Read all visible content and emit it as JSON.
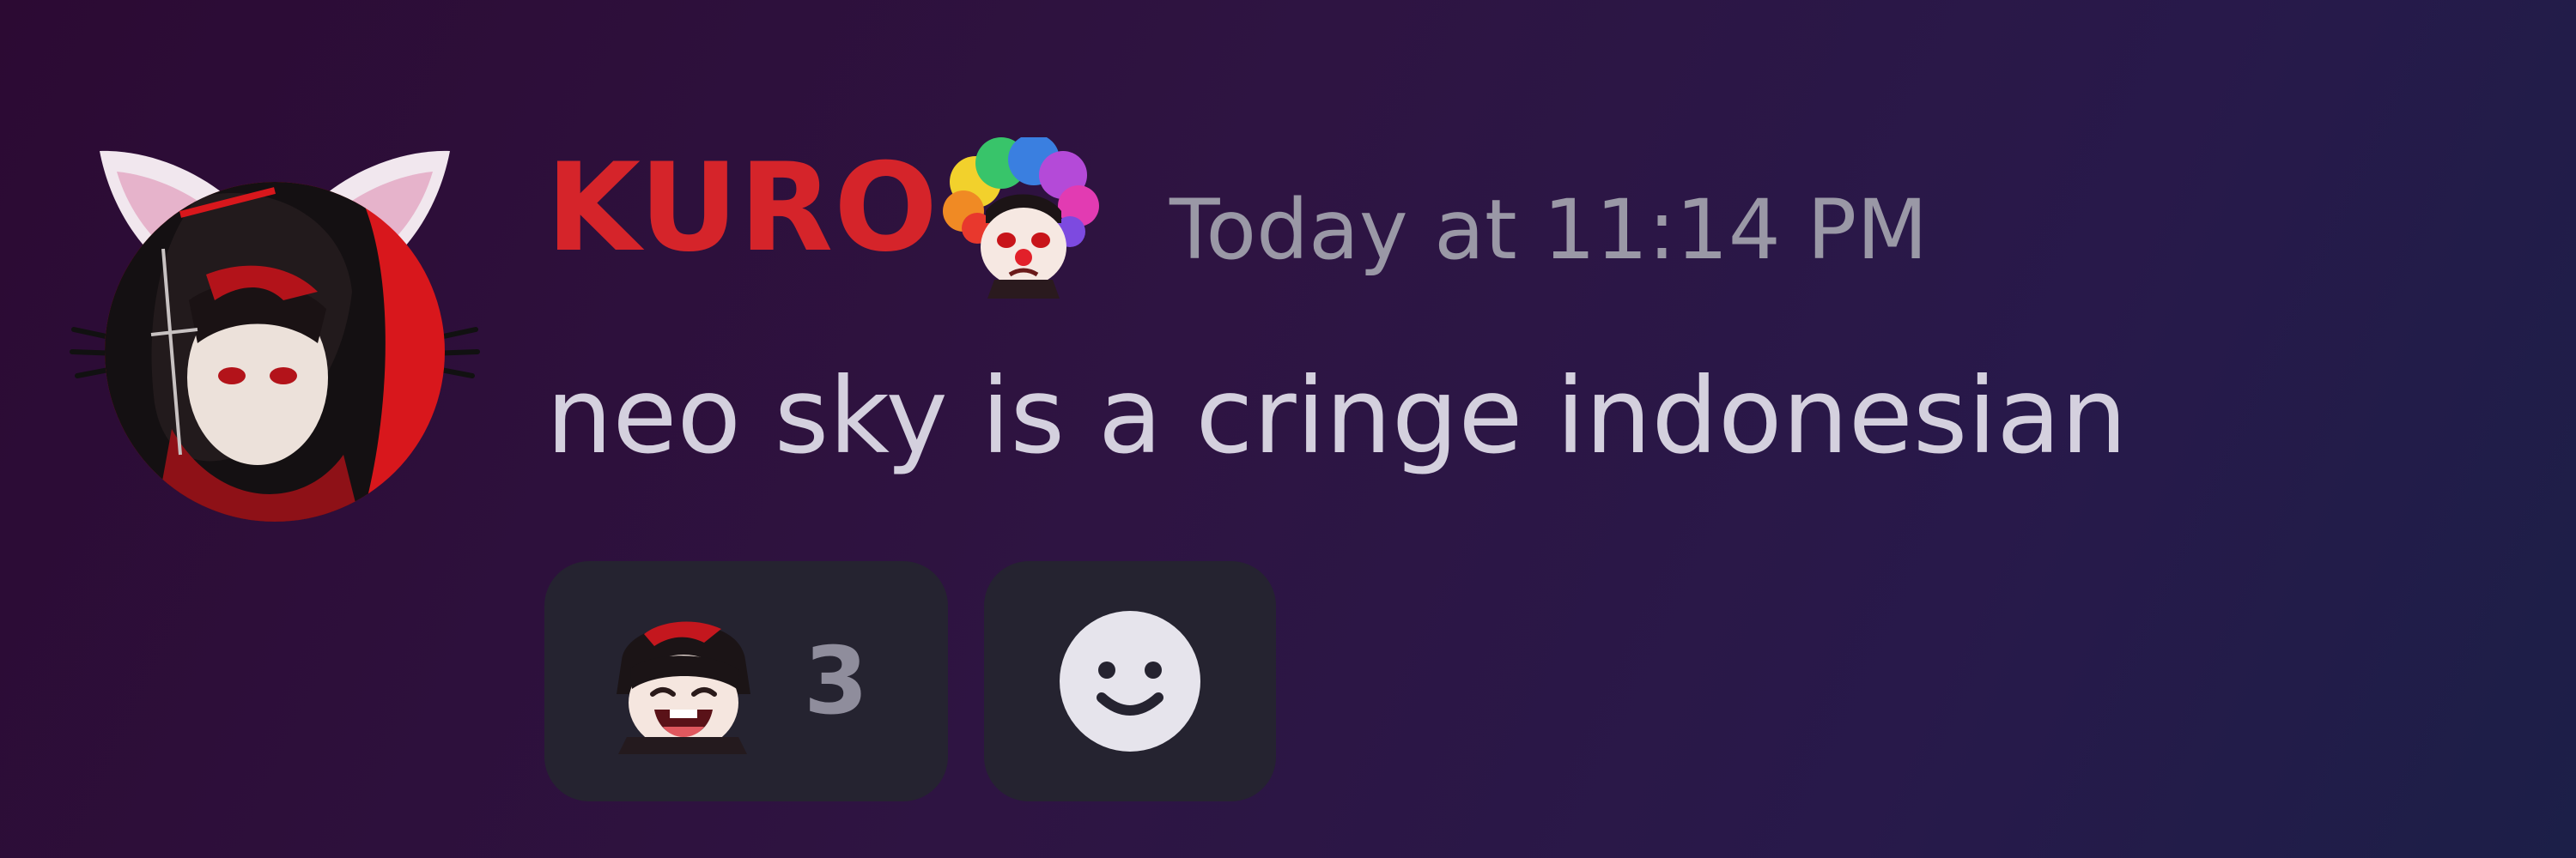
{
  "message": {
    "username": "KURO",
    "timestamp": "Today at 11:14 PM",
    "text": "neo sky is a cringe indonesian",
    "colors": {
      "username": "#d5242a",
      "timestamp": "#9a98a6",
      "text": "#d4d0de"
    },
    "icons": {
      "avatar": "cat-ear-avatar",
      "badge": "clown-afro-emoji"
    }
  },
  "reactions": [
    {
      "emoji": "laughing-anime-emoji",
      "count": "3"
    }
  ],
  "add_reaction": {
    "icon": "smiley-add-reaction-icon"
  }
}
